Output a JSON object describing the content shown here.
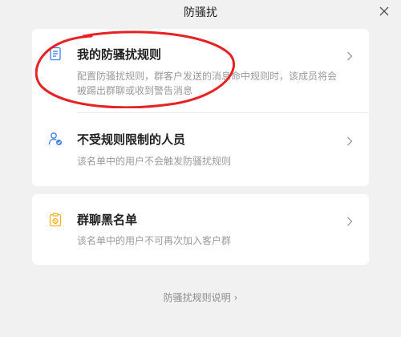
{
  "window": {
    "title": "防骚扰"
  },
  "cards": {
    "rules": {
      "items": [
        {
          "title": "我的防骚扰规则",
          "description": "配置防骚扰规则，群客户发送的消息命中规则时，该成员将会被踢出群聊或收到警告消息",
          "icon": "document-icon"
        },
        {
          "title": "不受规则限制的人员",
          "description": "该名单中的用户不会触发防骚扰规则",
          "icon": "user-check-icon"
        }
      ]
    },
    "blacklist": {
      "title": "群聊黑名单",
      "description": "该名单中的用户不可再次加入客户群",
      "icon": "blocked-list-icon"
    }
  },
  "footer": {
    "link_text": "防骚扰规则说明",
    "arrow": "›"
  },
  "colors": {
    "accent": "#3d7ef5",
    "blacklist_accent": "#f2b21b",
    "annotation": "#e62222"
  }
}
